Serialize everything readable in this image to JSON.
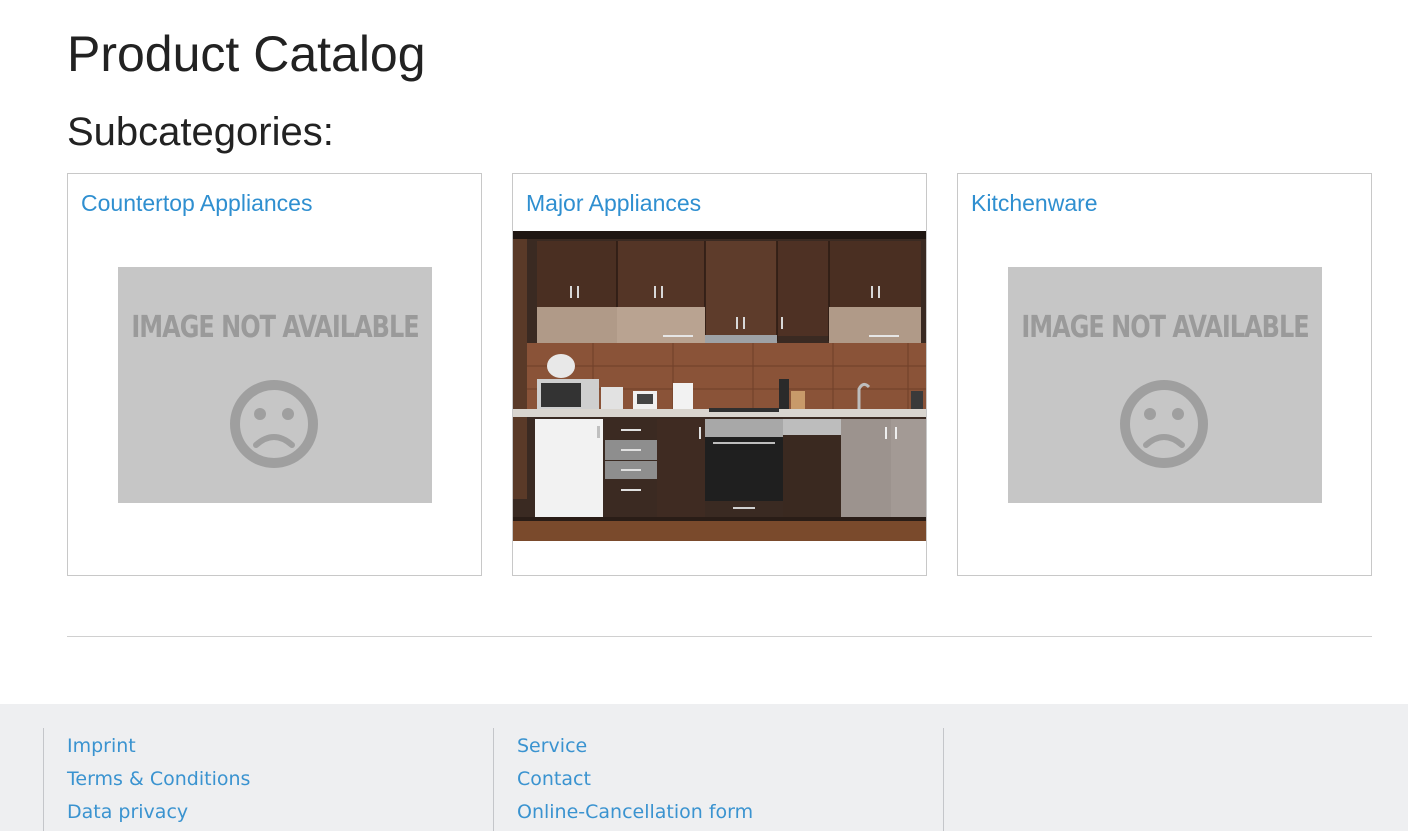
{
  "page": {
    "title": "Product Catalog",
    "subcategories_heading": "Subcategories:"
  },
  "subcategories": [
    {
      "name": "Countertop Appliances",
      "image": {
        "type": "placeholder",
        "text": "IMAGE NOT AVAILABLE",
        "icon": "sad-face-icon"
      }
    },
    {
      "name": "Major Appliances",
      "image": {
        "type": "photo",
        "description": "kitchen-photo"
      }
    },
    {
      "name": "Kitchenware",
      "image": {
        "type": "placeholder",
        "text": "IMAGE NOT AVAILABLE",
        "icon": "sad-face-icon"
      }
    }
  ],
  "footer": {
    "columns": [
      {
        "links": [
          "Imprint",
          "Terms & Conditions",
          "Data privacy"
        ]
      },
      {
        "links": [
          "Service",
          "Contact",
          "Online-Cancellation form"
        ]
      },
      {
        "links": []
      }
    ]
  },
  "colors": {
    "link": "#2f8fd0",
    "footer_bg": "#eeeff1",
    "placeholder_bg": "#c6c6c6",
    "placeholder_fg": "#9a9a9a"
  }
}
